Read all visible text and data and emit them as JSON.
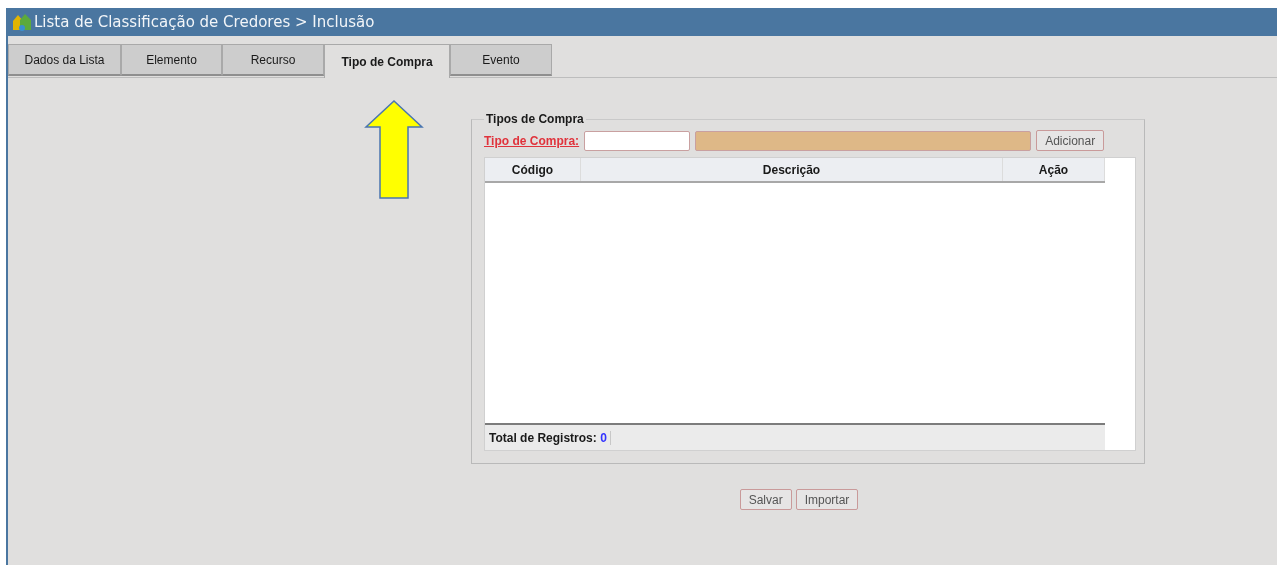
{
  "window": {
    "title": "Lista de Classificação de Credores > Inclusão"
  },
  "tabs": [
    {
      "label": "Dados da Lista",
      "selected": false
    },
    {
      "label": "Elemento",
      "selected": false
    },
    {
      "label": "Recurso",
      "selected": false
    },
    {
      "label": "Tipo de Compra",
      "selected": true
    },
    {
      "label": "Evento",
      "selected": false
    }
  ],
  "panel": {
    "legend": "Tipos de Compra",
    "field_label": "Tipo de Compra:",
    "add_button": "Adicionar",
    "table": {
      "columns": [
        "Código",
        "Descrição",
        "Ação"
      ],
      "total_label": "Total de Registros:",
      "total_count": "0"
    }
  },
  "buttons": [
    "Salvar",
    "Importar"
  ]
}
